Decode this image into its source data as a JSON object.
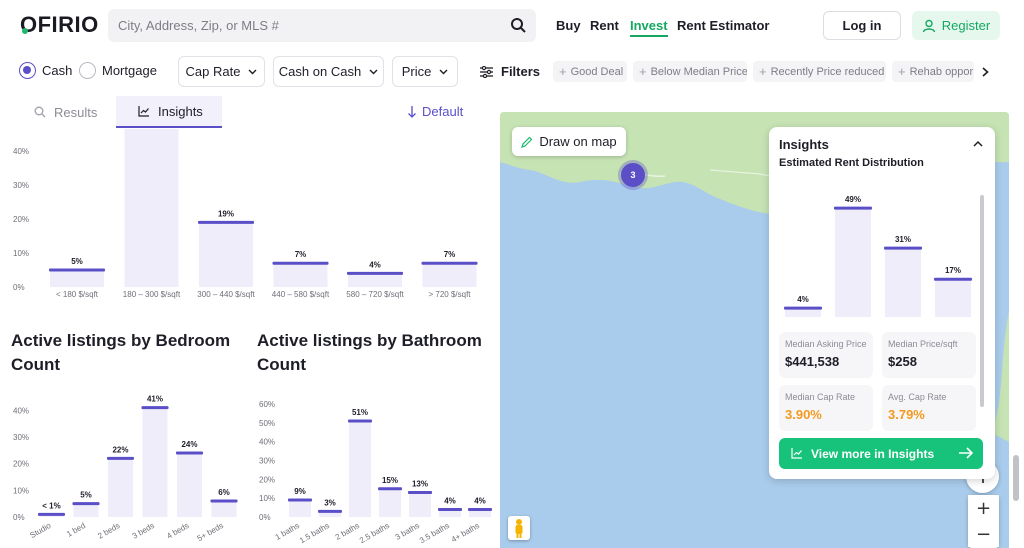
{
  "header": {
    "logo": "OFIRIO",
    "search_placeholder": "City, Address, Zip, or MLS #",
    "nav": [
      "Buy",
      "Rent",
      "Invest",
      "Rent Estimator"
    ],
    "active_nav": "Invest",
    "login": "Log in",
    "register": "Register"
  },
  "filters": {
    "cash": "Cash",
    "mortgage": "Mortgage",
    "cap_rate": "Cap Rate",
    "cash_on_cash": "Cash on Cash",
    "price": "Price",
    "filters": "Filters",
    "chips": [
      "Good Deal",
      "Below Median Price",
      "Recently Price reduced",
      "Rehab oppor"
    ]
  },
  "tabs": {
    "results": "Results",
    "insights": "Insights",
    "default": "Default"
  },
  "sections": {
    "bedroom_title_1": "Active listings by Bedroom",
    "bedroom_title_2": "Count",
    "bathroom_title_1": "Active listings by Bathroom",
    "bathroom_title_2": "Count"
  },
  "map": {
    "draw": "Draw on map",
    "cluster_count": "3",
    "zoom_in": "+",
    "zoom_out": "−"
  },
  "insights_card": {
    "title": "Insights",
    "subtitle": "Estimated Rent Distribution",
    "stats": [
      {
        "label": "Median Asking Price",
        "value": "$441,538"
      },
      {
        "label": "Median Price/sqft",
        "value": "$258"
      },
      {
        "label": "Median Cap Rate",
        "value": "3.90%"
      },
      {
        "label": "Avg. Cap Rate",
        "value": "3.79%"
      }
    ],
    "view_more": "View more in Insights"
  },
  "colors": {
    "accent": "#5b4fc7",
    "bar_fill": "#efedf9",
    "green": "#17c27a",
    "orange": "#f39a1e",
    "map_water": "#a9ccec",
    "map_land": "#c6e3b4"
  },
  "chart_data": [
    {
      "type": "bar",
      "categories": [
        "< 180 $/sqft",
        "180 – 300 $/sqft",
        "300 – 440 $/sqft",
        "440 – 580 $/sqft",
        "580 – 720 $/sqft",
        "> 720 $/sqft"
      ],
      "values": [
        5,
        58,
        19,
        7,
        4,
        7
      ],
      "data_labels": [
        "5%",
        "",
        "19%",
        "7%",
        "4%",
        "7%"
      ],
      "y_ticks": [
        "0%",
        "10%",
        "20%",
        "30%",
        "40%"
      ],
      "ylim": [
        0,
        40
      ]
    },
    {
      "type": "bar",
      "categories": [
        "Studio",
        "1 bed",
        "2 beds",
        "3 beds",
        "4 beds",
        "5+ beds"
      ],
      "values": [
        1,
        5,
        22,
        41,
        24,
        6
      ],
      "data_labels": [
        "< 1%",
        "5%",
        "22%",
        "41%",
        "24%",
        "6%"
      ],
      "y_ticks": [
        "0%",
        "10%",
        "20%",
        "30%",
        "40%"
      ],
      "ylim": [
        0,
        45
      ]
    },
    {
      "type": "bar",
      "categories": [
        "1 baths",
        "1.5 baths",
        "2 baths",
        "2.5 baths",
        "3 baths",
        "3.5 baths",
        "4+ baths"
      ],
      "values": [
        9,
        3,
        51,
        15,
        13,
        4,
        4
      ],
      "data_labels": [
        "9%",
        "3%",
        "51%",
        "15%",
        "13%",
        "4%",
        "4%"
      ],
      "y_ticks": [
        "0%",
        "10%",
        "20%",
        "30%",
        "40%",
        "50%",
        "60%"
      ],
      "ylim": [
        0,
        60
      ]
    },
    {
      "type": "bar",
      "categories": [
        "",
        "",
        "",
        ""
      ],
      "values": [
        4,
        49,
        31,
        17
      ],
      "data_labels": [
        "4%",
        "49%",
        "31%",
        "17%"
      ],
      "ylim": [
        0,
        54
      ]
    }
  ]
}
